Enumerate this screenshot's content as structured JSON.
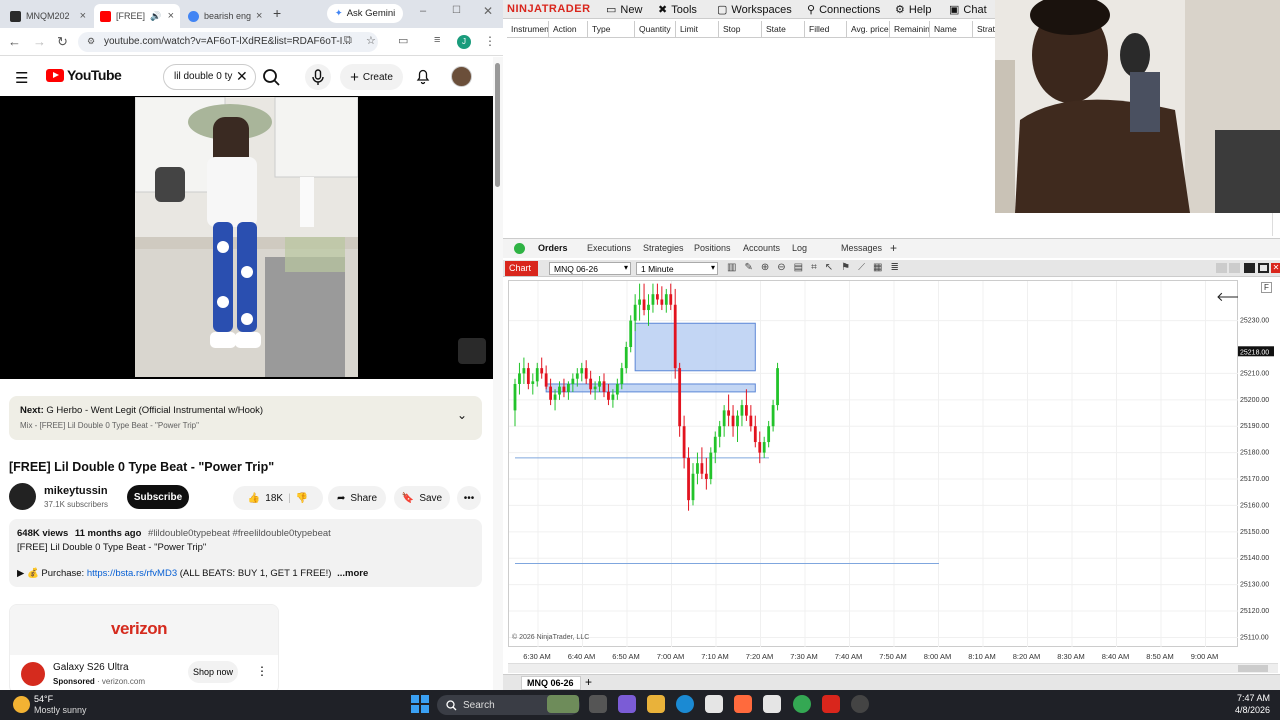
{
  "browser": {
    "tabs": [
      {
        "label": "MNQM202",
        "favicon_color": "#2b2b2b"
      },
      {
        "label": "[FREE]",
        "favicon_color": "#ff0000"
      },
      {
        "label": "bearish eng",
        "favicon_color": "#4285f4"
      }
    ],
    "new_tab_icon": "plus-icon",
    "gemini_label": "Ask Gemini",
    "url": "youtube.com/watch?v=AF6oT-lXdRE&list=RDAF6oT-I...",
    "profile_initial": "J"
  },
  "youtube": {
    "logo_text": "YouTube",
    "search_value": "lil double 0 ty",
    "create_label": "Create",
    "next_label": "Next:",
    "next_title": "G Herbo - Went Legit (Official Instrumental w/Hook)",
    "mix_label": "Mix - [FREE] Lil Double 0 Type Beat - \"Power Trip\"",
    "video_title": "[FREE] Lil Double 0 Type Beat - \"Power Trip\"",
    "channel_name": "mikeytussin",
    "subscribers": "37.1K subscribers",
    "subscribe_label": "Subscribe",
    "likes": "18K",
    "share_label": "Share",
    "save_label": "Save",
    "views": "648K views",
    "age": "11 months ago",
    "hashtags": "#lildouble0typebeat #freelildouble0typebeat",
    "desc_line1": "[FREE] Lil Double 0 Type Beat - \"Power Trip\"",
    "purchase_prefix": "▶ 💰 Purchase: ",
    "purchase_link": "https://bsta.rs/rfvMD3",
    "purchase_suffix": " (ALL BEATS: BUY 1, GET 1 FREE!)",
    "more_label": "...more",
    "ad_brand": "verizon",
    "ad_title": "Galaxy S26 Ultra",
    "ad_sponsored": "Sponsored",
    "ad_domain": "verizon.com",
    "ad_cta": "Shop now"
  },
  "ninjatrader": {
    "brand": "NINJATRADER",
    "menu": [
      "New",
      "Tools",
      "Workspaces",
      "Connections",
      "Help",
      "Chat"
    ],
    "order_columns": [
      "Instrument",
      "Action",
      "Type",
      "Quantity",
      "Limit",
      "Stop",
      "State",
      "Filled",
      "Avg. price",
      "Remaining",
      "Name",
      "Strat"
    ],
    "bottom_tabs": [
      "Orders",
      "Executions",
      "Strategies",
      "Positions",
      "Accounts",
      "Log",
      "Messages"
    ],
    "chart_label": "Chart",
    "instrument": "MNQ 06-26",
    "interval": "1 Minute",
    "copyright": "© 2026 NinjaTrader, LLC",
    "tab_name": "MNQ 06-26",
    "f_label": "F",
    "last_price": "25218.00"
  },
  "chart_data": {
    "type": "candlestick",
    "title": "",
    "xlabel": "",
    "ylabel": "",
    "x_ticks": [
      "6:30 AM",
      "6:40 AM",
      "6:50 AM",
      "7:00 AM",
      "7:10 AM",
      "7:20 AM",
      "7:30 AM",
      "7:40 AM",
      "7:50 AM",
      "8:00 AM",
      "8:10 AM",
      "8:20 AM",
      "8:30 AM",
      "8:40 AM",
      "8:50 AM",
      "9:00 AM"
    ],
    "y_ticks": [
      25230,
      25210,
      25200,
      25190,
      25180,
      25170,
      25160,
      25150,
      25140,
      25130,
      25120,
      25110
    ],
    "ylim": [
      25106,
      25245
    ],
    "last_price": 25218.0,
    "series": [
      {
        "values": [
          [
            0,
            25196,
            25208,
            25190,
            25206
          ],
          [
            1,
            25206,
            25214,
            25202,
            25210
          ],
          [
            2,
            25210,
            25216,
            25206,
            25212
          ],
          [
            3,
            25212,
            25214,
            25204,
            25206
          ],
          [
            4,
            25206,
            25210,
            25202,
            25207
          ],
          [
            5,
            25207,
            25214,
            25205,
            25212
          ],
          [
            6,
            25212,
            25216,
            25208,
            25210
          ],
          [
            7,
            25210,
            25213,
            25204,
            25205
          ],
          [
            8,
            25205,
            25208,
            25198,
            25200
          ],
          [
            9,
            25200,
            25204,
            25196,
            25202
          ],
          [
            10,
            25202,
            25207,
            25200,
            25205
          ],
          [
            11,
            25205,
            25208,
            25201,
            25203
          ],
          [
            12,
            25203,
            25207,
            25200,
            25206
          ],
          [
            13,
            25206,
            25210,
            25203,
            25208
          ],
          [
            14,
            25208,
            25212,
            25205,
            25210
          ],
          [
            15,
            25210,
            25214,
            25207,
            25212
          ],
          [
            16,
            25212,
            25215,
            25206,
            25208
          ],
          [
            17,
            25208,
            25211,
            25202,
            25204
          ],
          [
            18,
            25204,
            25207,
            25200,
            25205
          ],
          [
            19,
            25205,
            25209,
            25203,
            25207
          ],
          [
            20,
            25207,
            25210,
            25201,
            25203
          ],
          [
            21,
            25203,
            25206,
            25198,
            25200
          ],
          [
            22,
            25200,
            25204,
            25197,
            25202
          ],
          [
            23,
            25202,
            25208,
            25200,
            25206
          ],
          [
            24,
            25206,
            25214,
            25204,
            25212
          ],
          [
            25,
            25212,
            25222,
            25210,
            25220
          ],
          [
            26,
            25220,
            25232,
            25218,
            25230
          ],
          [
            27,
            25230,
            25240,
            25226,
            25236
          ],
          [
            28,
            25236,
            25244,
            25230,
            25238
          ],
          [
            29,
            25238,
            25244,
            25232,
            25234
          ],
          [
            30,
            25234,
            25240,
            25228,
            25236
          ],
          [
            31,
            25236,
            25244,
            25233,
            25240
          ],
          [
            32,
            25240,
            25244,
            25236,
            25238
          ],
          [
            33,
            25238,
            25243,
            25234,
            25236
          ],
          [
            34,
            25236,
            25242,
            25233,
            25240
          ],
          [
            35,
            25240,
            25244,
            25234,
            25236
          ],
          [
            36,
            25236,
            25242,
            25208,
            25212
          ],
          [
            37,
            25212,
            25214,
            25186,
            25190
          ],
          [
            38,
            25190,
            25194,
            25174,
            25178
          ],
          [
            39,
            25178,
            25182,
            25158,
            25162
          ],
          [
            40,
            25162,
            25176,
            25160,
            25172
          ],
          [
            41,
            25172,
            25180,
            25168,
            25176
          ],
          [
            42,
            25176,
            25182,
            25170,
            25172
          ],
          [
            43,
            25172,
            25178,
            25166,
            25170
          ],
          [
            44,
            25170,
            25182,
            25168,
            25180
          ],
          [
            45,
            25180,
            25188,
            25176,
            25186
          ],
          [
            46,
            25186,
            25192,
            25182,
            25190
          ],
          [
            47,
            25190,
            25198,
            25186,
            25196
          ],
          [
            48,
            25196,
            25202,
            25190,
            25194
          ],
          [
            49,
            25194,
            25198,
            25186,
            25190
          ],
          [
            50,
            25190,
            25196,
            25184,
            25194
          ],
          [
            51,
            25194,
            25200,
            25190,
            25198
          ],
          [
            52,
            25198,
            25204,
            25192,
            25194
          ],
          [
            53,
            25194,
            25198,
            25188,
            25190
          ],
          [
            54,
            25190,
            25194,
            25182,
            25184
          ],
          [
            55,
            25184,
            25188,
            25176,
            25180
          ],
          [
            56,
            25180,
            25186,
            25178,
            25184
          ],
          [
            57,
            25184,
            25192,
            25182,
            25190
          ],
          [
            58,
            25190,
            25200,
            25188,
            25198
          ],
          [
            59,
            25198,
            25214,
            25196,
            25212
          ]
        ]
      }
    ],
    "zones": [
      {
        "x0": 27,
        "x1": 54,
        "y0": 25211,
        "y1": 25229
      },
      {
        "x0": 7,
        "x1": 54,
        "y0": 25203,
        "y1": 25206
      }
    ],
    "lines": [
      25178,
      25138
    ]
  },
  "taskbar": {
    "temp": "54°F",
    "weather": "Mostly sunny",
    "search_placeholder": "Search",
    "time": "7:47 AM",
    "date": "4/8/2026"
  }
}
